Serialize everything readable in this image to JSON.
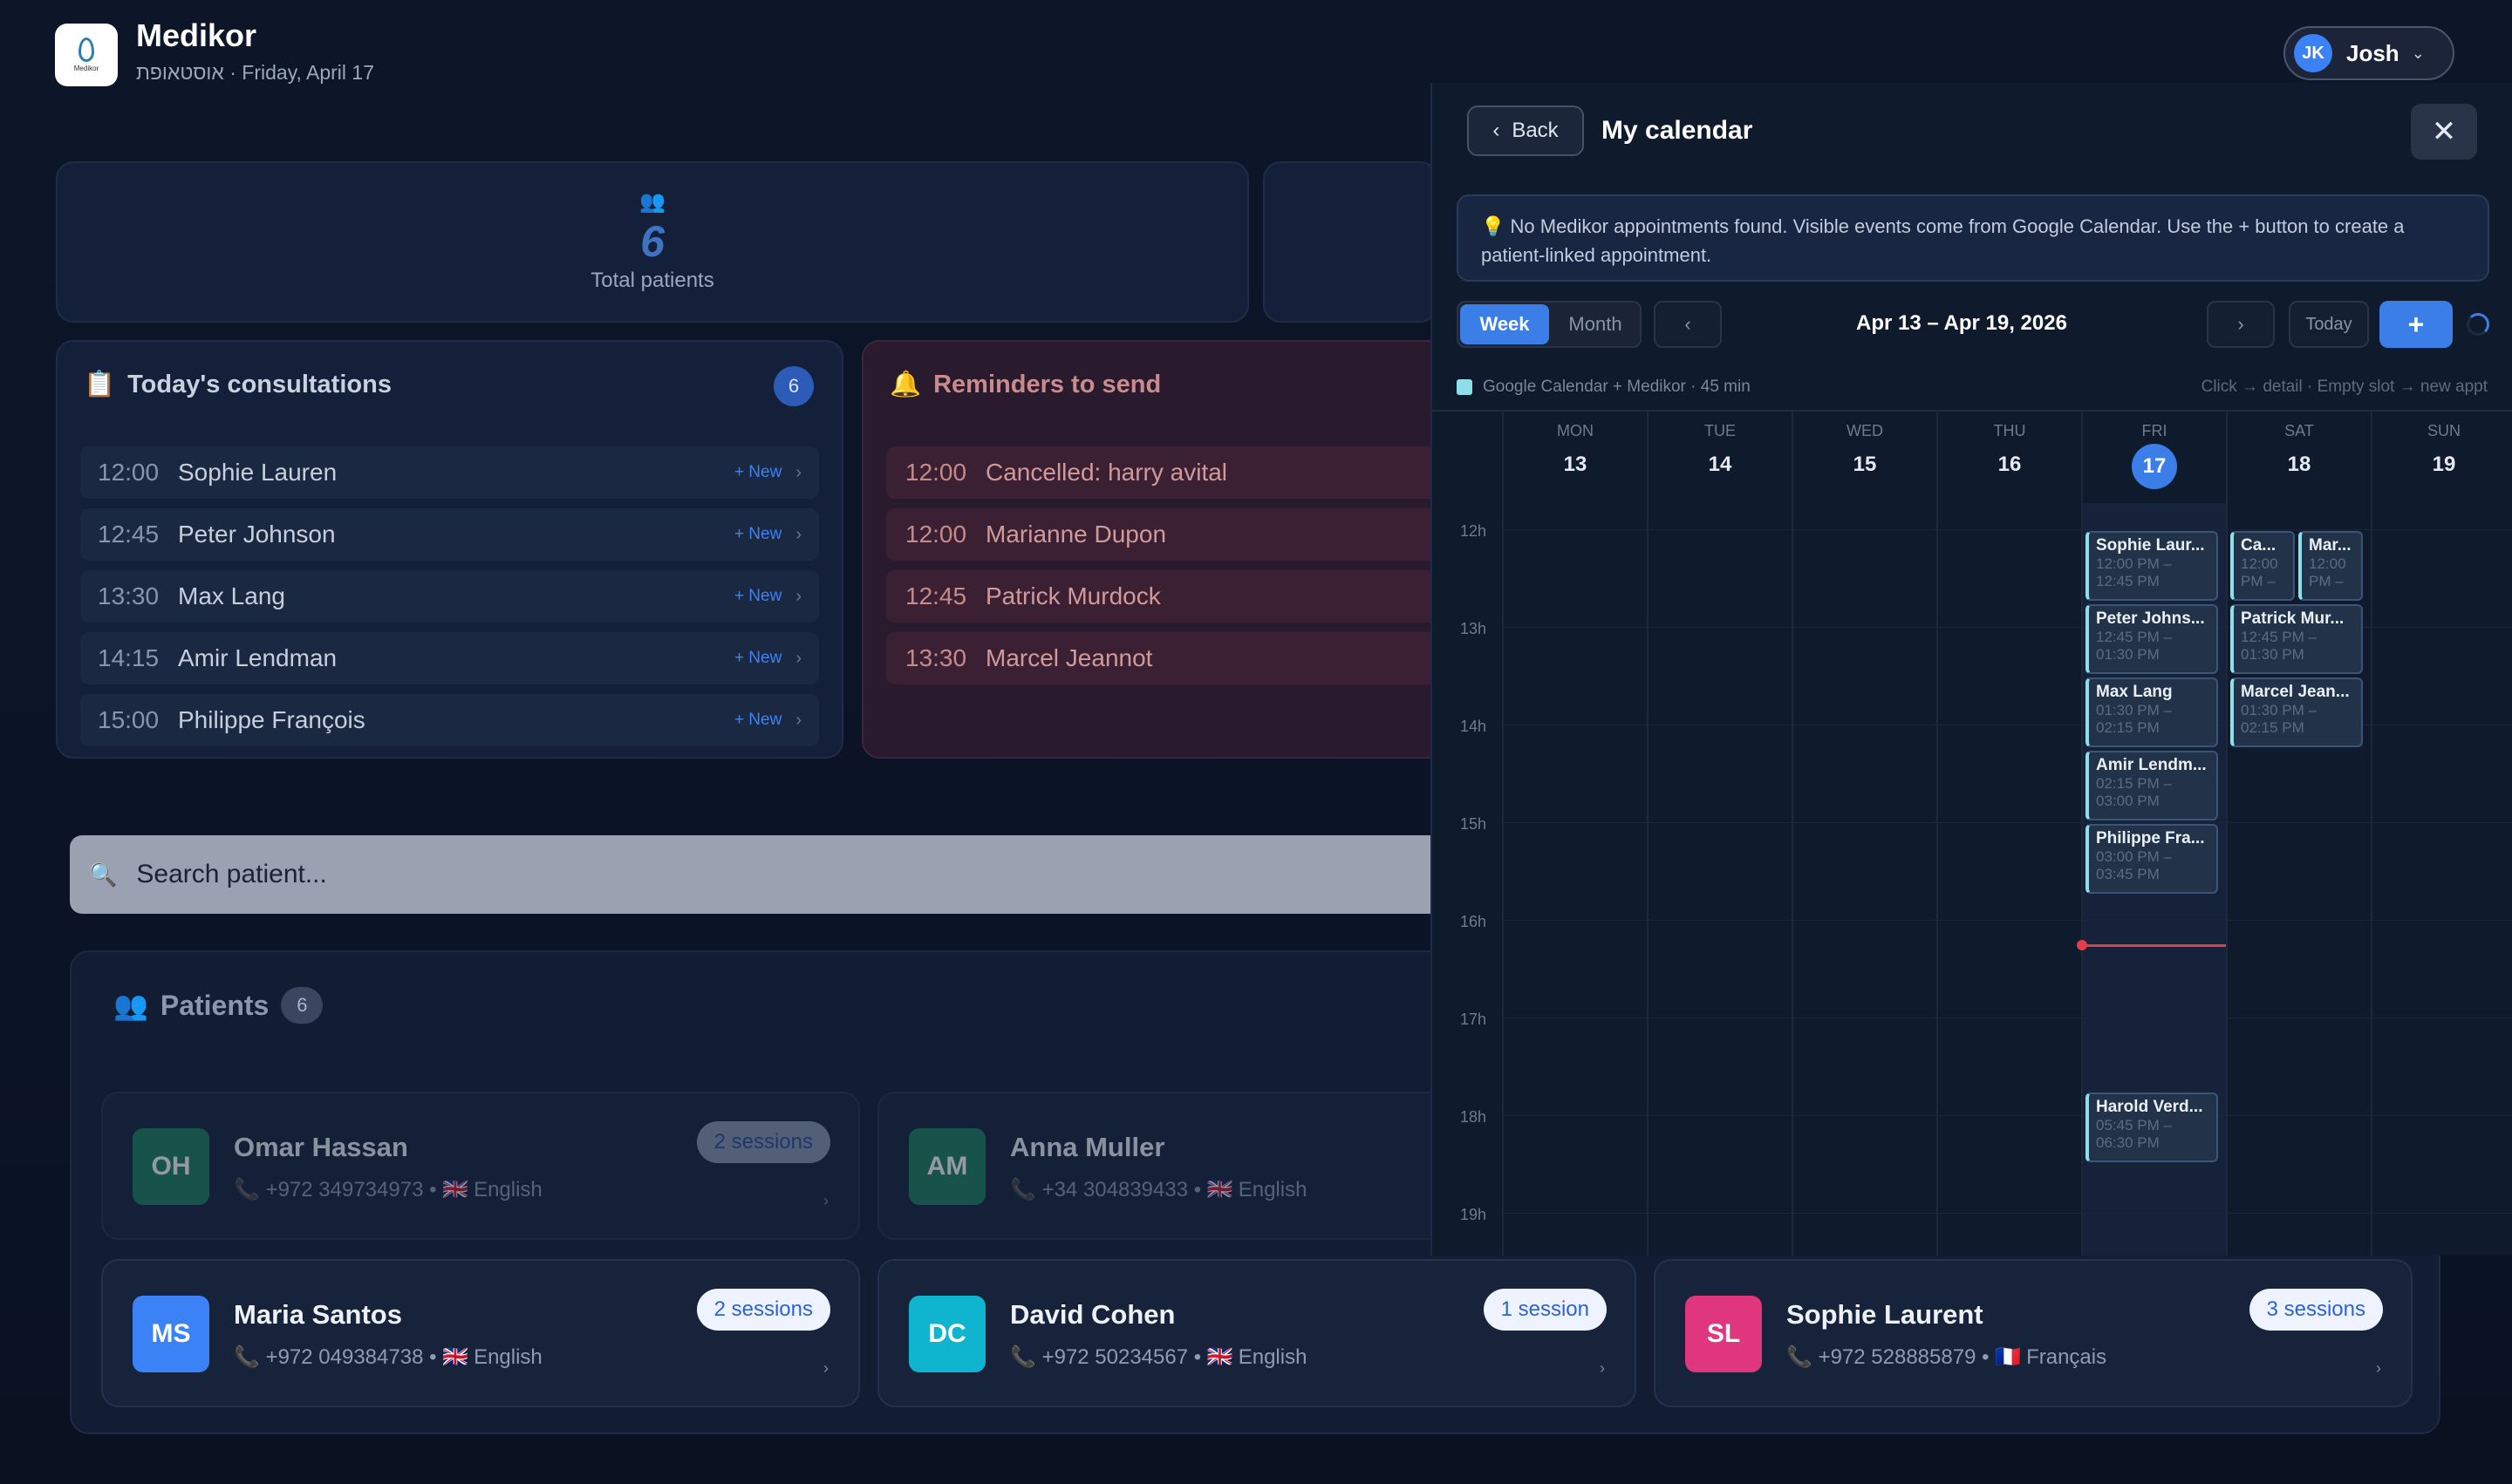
{
  "app": {
    "name": "Medikor",
    "subtitle": "אוסטאופת · Friday, April 17",
    "logo_text": "Medikor"
  },
  "user": {
    "initials": "JK",
    "name": "Josh"
  },
  "stats": {
    "total_patients": {
      "value": "6",
      "label": "Total patients"
    }
  },
  "consultations": {
    "title": "Today's consultations",
    "count": "6",
    "new_label": "+ New",
    "rows": [
      {
        "time": "12:00",
        "name": "Sophie Lauren"
      },
      {
        "time": "12:45",
        "name": "Peter Johnson"
      },
      {
        "time": "13:30",
        "name": "Max Lang"
      },
      {
        "time": "14:15",
        "name": "Amir Lendman"
      },
      {
        "time": "15:00",
        "name": "Philippe François"
      }
    ]
  },
  "reminders": {
    "title": "Reminders to send",
    "rows": [
      {
        "time": "12:00",
        "name": "Cancelled: harry avital"
      },
      {
        "time": "12:00",
        "name": "Marianne Dupon"
      },
      {
        "time": "12:45",
        "name": "Patrick Murdock"
      },
      {
        "time": "13:30",
        "name": "Marcel Jeannot"
      }
    ]
  },
  "search": {
    "placeholder": "Search patient..."
  },
  "patients": {
    "title": "Patients",
    "count": "6",
    "cards": [
      {
        "initials": "OH",
        "name": "Omar Hassan",
        "phone": "+972 349734973",
        "lang": "English",
        "flag": "🇬🇧",
        "sessions": "2 sessions",
        "color": "#1c7f5f"
      },
      {
        "initials": "AM",
        "name": "Anna Muller",
        "phone": "+34 304839433",
        "lang": "English",
        "flag": "🇬🇧",
        "sessions": "",
        "color": "#1c7f5f"
      },
      {
        "initials": "MS",
        "name": "Maria Santos",
        "phone": "+972 049384738",
        "lang": "English",
        "flag": "🇬🇧",
        "sessions": "2 sessions",
        "color": "#3b82f6"
      },
      {
        "initials": "DC",
        "name": "David Cohen",
        "phone": "+972 50234567",
        "lang": "English",
        "flag": "🇬🇧",
        "sessions": "1 session",
        "color": "#0fb5cf"
      },
      {
        "initials": "SL",
        "name": "Sophie Laurent",
        "phone": "+972 528885879",
        "lang": "Français",
        "flag": "🇫🇷",
        "sessions": "3 sessions",
        "color": "#e0367d"
      }
    ]
  },
  "calendar": {
    "back_label": "Back",
    "title": "My calendar",
    "notice": "💡 No Medikor appointments found. Visible events come from Google Calendar. Use the + button to create a patient-linked appointment.",
    "tabs": [
      "Week",
      "Month"
    ],
    "active_tab": "Week",
    "prev": "‹",
    "next": "›",
    "range": "Apr 13 – Apr 19, 2026",
    "today_label": "Today",
    "add_label": "+",
    "legend": "Google Calendar + Medikor · 45 min",
    "hint": "Click → detail · Empty slot → new appt",
    "days": [
      {
        "name": "MON",
        "num": "13"
      },
      {
        "name": "TUE",
        "num": "14"
      },
      {
        "name": "WED",
        "num": "15"
      },
      {
        "name": "THU",
        "num": "16"
      },
      {
        "name": "FRI",
        "num": "17",
        "today": true
      },
      {
        "name": "SAT",
        "num": "18"
      },
      {
        "name": "SUN",
        "num": "19"
      }
    ],
    "hours": [
      "12h",
      "13h",
      "14h",
      "15h",
      "16h",
      "17h",
      "18h",
      "19h"
    ],
    "now_time": "16:15",
    "events": [
      {
        "day": 4,
        "start": "12:00",
        "end": "12:45",
        "name": "Sophie Laur...",
        "time": "12:00 PM – 12:45 PM"
      },
      {
        "day": 4,
        "start": "12:45",
        "end": "13:30",
        "name": "Peter Johns...",
        "time": "12:45 PM – 01:30 PM"
      },
      {
        "day": 4,
        "start": "13:30",
        "end": "14:15",
        "name": "Max Lang",
        "time": "01:30 PM – 02:15 PM"
      },
      {
        "day": 4,
        "start": "14:15",
        "end": "15:00",
        "name": "Amir Lendm...",
        "time": "02:15 PM – 03:00 PM"
      },
      {
        "day": 4,
        "start": "15:00",
        "end": "15:45",
        "name": "Philippe Fra...",
        "time": "03:00 PM – 03:45 PM"
      },
      {
        "day": 4,
        "start": "17:45",
        "end": "18:30",
        "name": "Harold Verd...",
        "time": "05:45 PM – 06:30 PM"
      },
      {
        "day": 5,
        "start": "12:00",
        "end": "12:45",
        "name": "Ca...",
        "time": "12:00 PM –",
        "lane": 0,
        "lanes": 2
      },
      {
        "day": 5,
        "start": "12:00",
        "end": "12:45",
        "name": "Mar...",
        "time": "12:00 PM –",
        "lane": 1,
        "lanes": 2
      },
      {
        "day": 5,
        "start": "12:45",
        "end": "13:30",
        "name": "Patrick Mur...",
        "time": "12:45 PM – 01:30 PM"
      },
      {
        "day": 5,
        "start": "13:30",
        "end": "14:15",
        "name": "Marcel Jean...",
        "time": "01:30 PM – 02:15 PM"
      }
    ]
  }
}
